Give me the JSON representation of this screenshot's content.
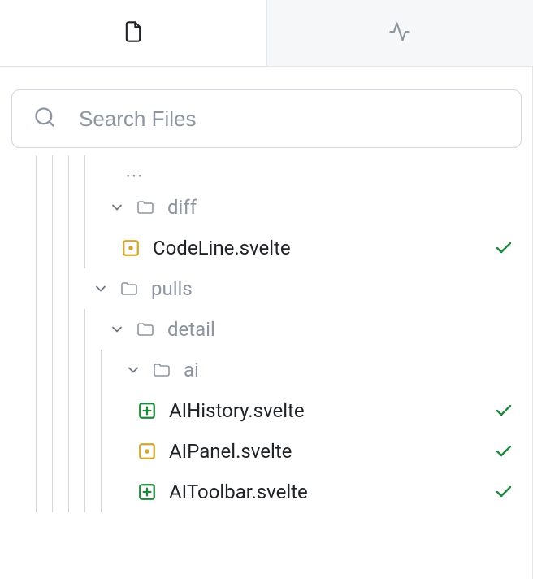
{
  "tabs": {
    "files": "files",
    "activity": "activity"
  },
  "search": {
    "placeholder": "Search Files"
  },
  "colors": {
    "folder_text": "#8d96a0",
    "file_text": "#1f2328",
    "check_green": "#1f883d",
    "icon_modified": "#d4a72c",
    "icon_added": "#1f883d",
    "guide": "#d0d7de"
  },
  "tree": {
    "diff": {
      "label": "diff",
      "files": [
        {
          "name": "CodeLine.svelte",
          "status": "modified",
          "checked": true
        }
      ]
    },
    "pulls": {
      "label": "pulls",
      "detail": {
        "label": "detail",
        "ai": {
          "label": "ai",
          "files": [
            {
              "name": "AIHistory.svelte",
              "status": "added",
              "checked": true
            },
            {
              "name": "AIPanel.svelte",
              "status": "modified",
              "checked": true
            },
            {
              "name": "AIToolbar.svelte",
              "status": "added",
              "checked": true
            }
          ]
        }
      }
    }
  }
}
